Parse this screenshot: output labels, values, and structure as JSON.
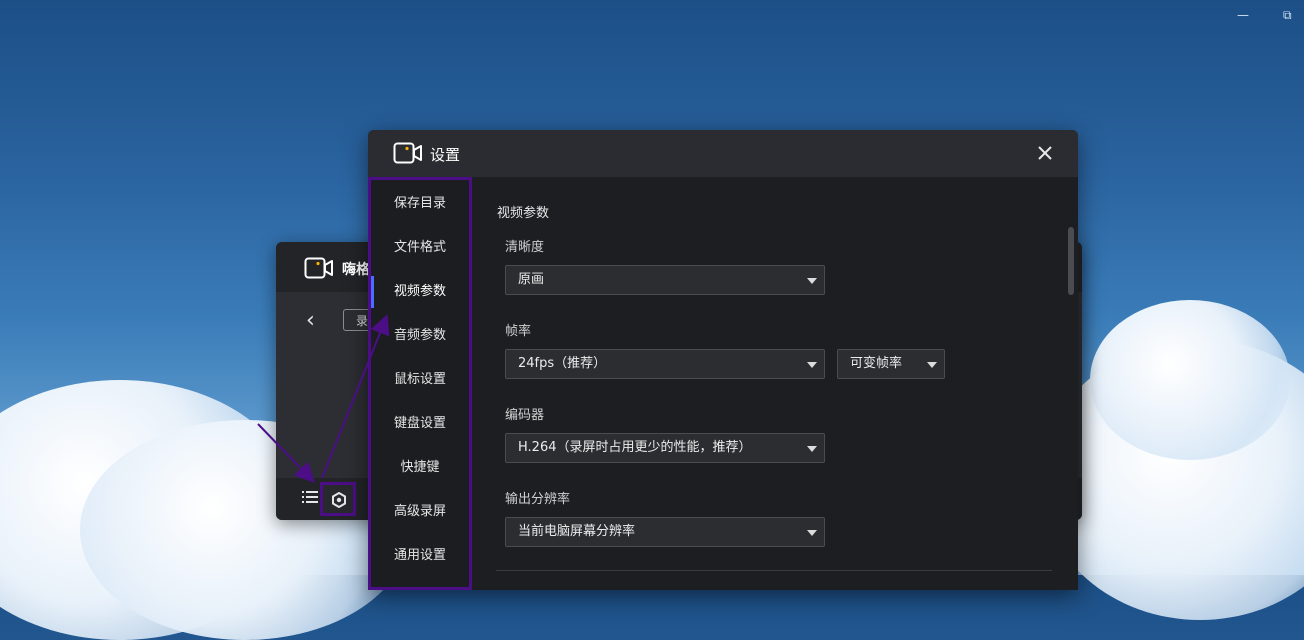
{
  "desktop": {
    "minimize_glyph": "—",
    "restore_glyph": "⧉"
  },
  "mini_window": {
    "title": "嗨格",
    "back_glyph": "‹",
    "tab_label": "录"
  },
  "dialog": {
    "title": "设置",
    "close_glyph": "✕",
    "nav": [
      {
        "label": "保存目录"
      },
      {
        "label": "文件格式"
      },
      {
        "label": "视频参数"
      },
      {
        "label": "音频参数"
      },
      {
        "label": "鼠标设置"
      },
      {
        "label": "键盘设置"
      },
      {
        "label": "快捷键"
      },
      {
        "label": "高级录屏"
      },
      {
        "label": "通用设置"
      }
    ],
    "active_nav": "视频参数",
    "section_title": "视频参数",
    "fields": {
      "clarity": {
        "label": "清晰度",
        "value": "原画"
      },
      "framerate": {
        "label": "帧率",
        "value": "24fps（推荐）",
        "mode_value": "可变帧率"
      },
      "encoder": {
        "label": "编码器",
        "value": "H.264（录屏时占用更少的性能，推荐）"
      },
      "resolution": {
        "label": "输出分辨率",
        "value": "当前电脑屏幕分辨率"
      }
    }
  },
  "colors": {
    "annotation": "#4b0e86",
    "accent": "#4a6cff",
    "logo_dot": "#f5b400"
  }
}
